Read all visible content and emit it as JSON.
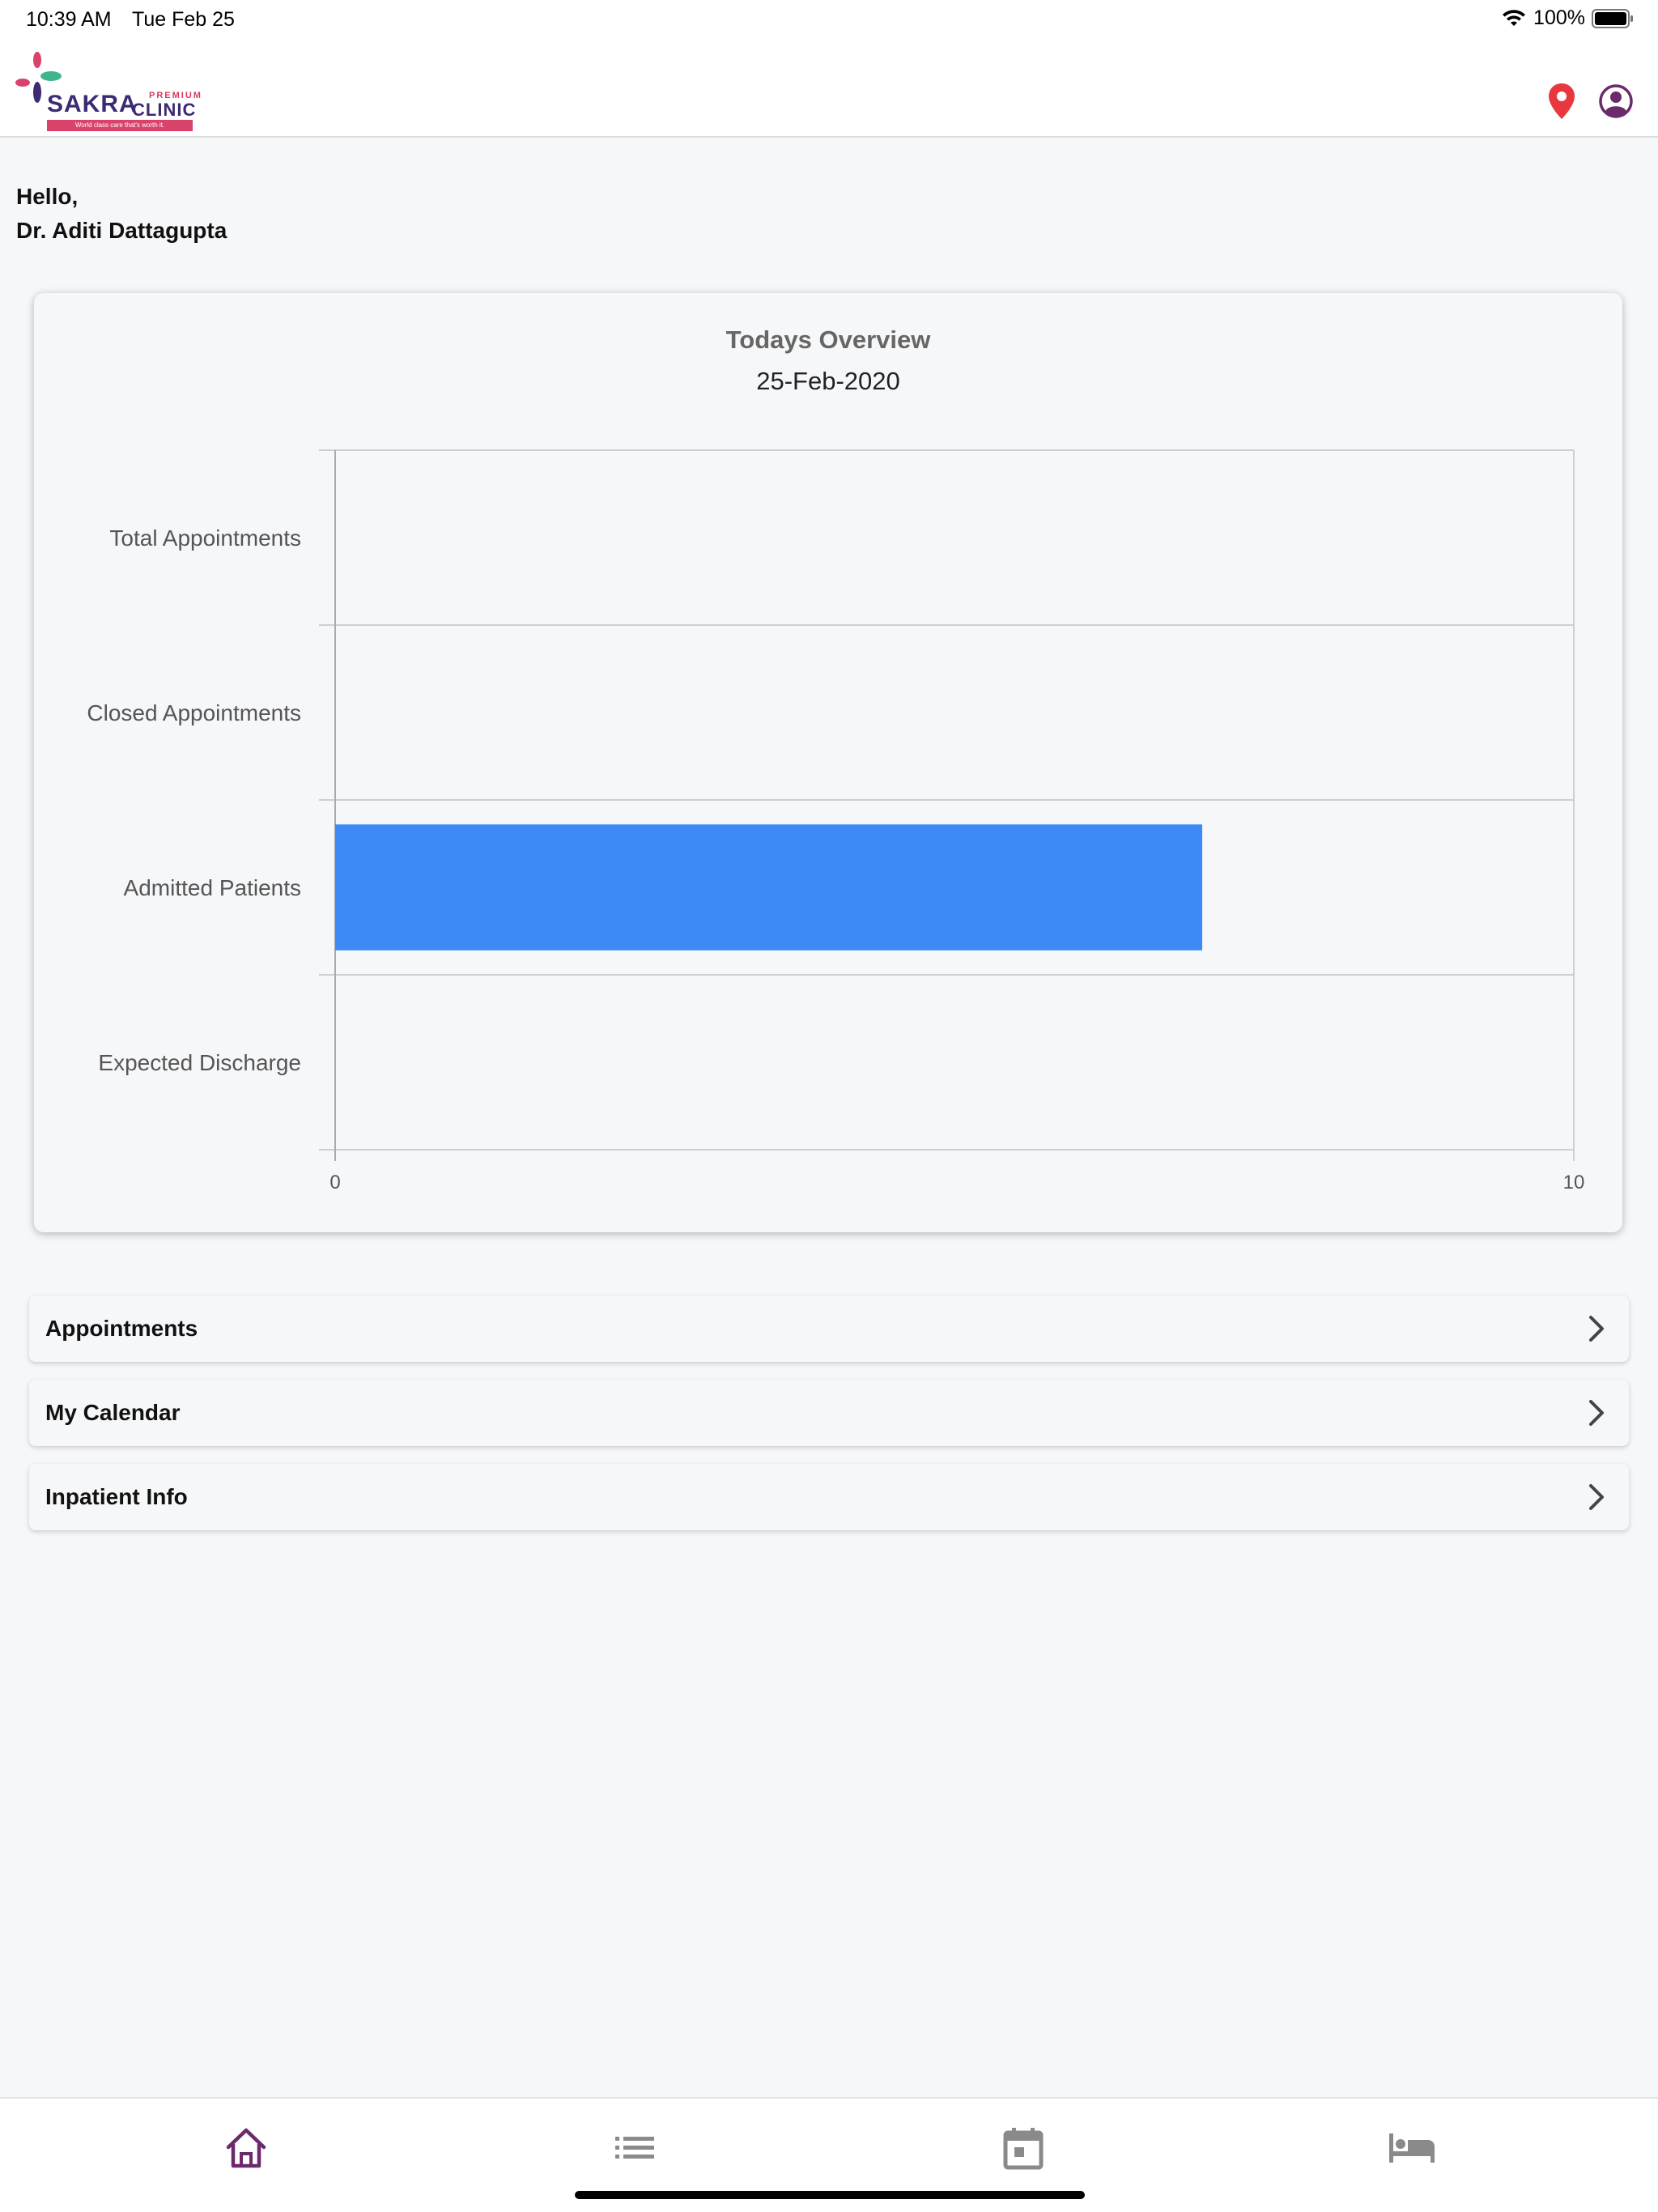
{
  "status_bar": {
    "time": "10:39 AM",
    "date": "Tue Feb 25",
    "battery": "100%"
  },
  "header": {
    "logo": {
      "brand": "SAKRA",
      "premium": "PREMIUM",
      "clinic": "CLINIC",
      "tagline": "World class care that's worth it."
    },
    "icons": [
      "location-pin-icon",
      "profile-icon"
    ]
  },
  "greeting": {
    "line1": "Hello,",
    "line2": "Dr. Aditi Dattagupta"
  },
  "chart_data": {
    "type": "bar",
    "orientation": "horizontal",
    "title": "Todays Overview",
    "subtitle": "25-Feb-2020",
    "categories": [
      "Total Appointments",
      "Closed Appointments",
      "Admitted Patients",
      "Expected Discharge"
    ],
    "values": [
      0,
      0,
      7,
      0
    ],
    "xlim": [
      0,
      10
    ],
    "x_ticks": [
      "0",
      "10"
    ],
    "bar_color": "#3d8af7",
    "grid": true
  },
  "menu": [
    {
      "label": "Appointments"
    },
    {
      "label": "My Calendar"
    },
    {
      "label": "Inpatient Info"
    }
  ],
  "tab_bar": {
    "tabs": [
      {
        "icon": "home-icon",
        "active": true
      },
      {
        "icon": "list-icon",
        "active": false
      },
      {
        "icon": "calendar-icon",
        "active": false
      },
      {
        "icon": "bed-icon",
        "active": false
      }
    ],
    "active_color": "#6b2a6b",
    "inactive_color": "#8a8a8a"
  }
}
